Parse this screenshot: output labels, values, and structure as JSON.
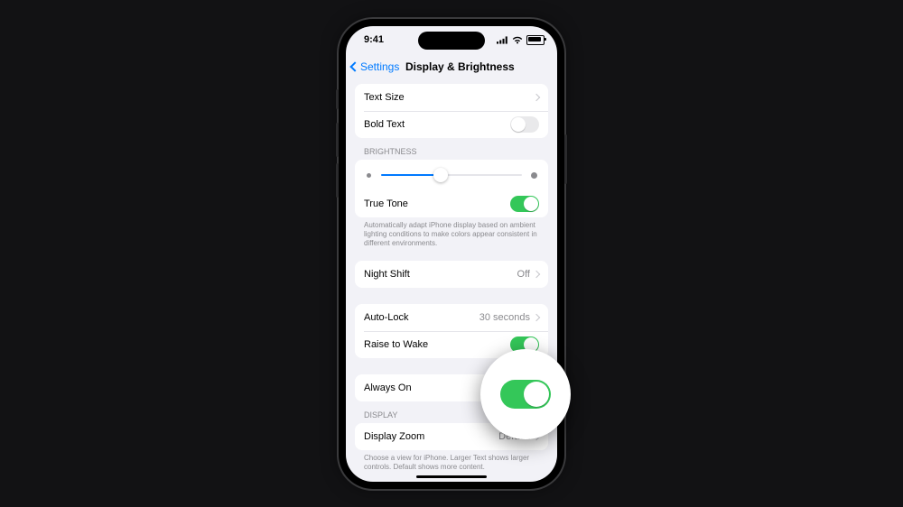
{
  "status": {
    "time": "9:41"
  },
  "nav": {
    "back": "Settings",
    "title": "Display & Brightness"
  },
  "rows": {
    "text_size": "Text Size",
    "bold_text": "Bold Text",
    "true_tone": "True Tone",
    "night_shift": "Night Shift",
    "night_shift_val": "Off",
    "auto_lock": "Auto-Lock",
    "auto_lock_val": "30 seconds",
    "raise_to_wake": "Raise to Wake",
    "always_on": "Always On",
    "display_zoom": "Display Zoom",
    "display_zoom_val": "Default"
  },
  "headers": {
    "brightness": "BRIGHTNESS",
    "display": "DISPLAY"
  },
  "footers": {
    "true_tone": "Automatically adapt iPhone display based on ambient lighting conditions to make colors appear consistent in different environments.",
    "display_zoom": "Choose a view for iPhone. Larger Text shows larger controls. Default shows more content."
  },
  "toggles": {
    "bold_text": false,
    "true_tone": true,
    "raise_to_wake": true,
    "always_on": true
  },
  "brightness_pct": 42
}
